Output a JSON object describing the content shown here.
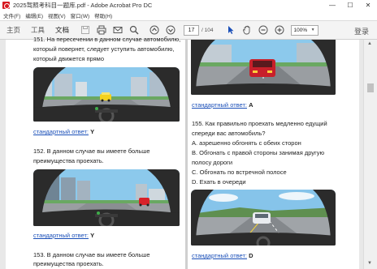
{
  "window": {
    "title": "2025驾照考科目一题库.pdf - Adobe Acrobat Pro DC",
    "controls": [
      "—",
      "☐",
      "✕"
    ]
  },
  "menu": [
    "文件(F)",
    "编辑(E)",
    "视图(V)",
    "窗口(W)",
    "帮助(H)"
  ],
  "toolbar": {
    "tabs": [
      "主页",
      "工具",
      "文档"
    ],
    "icons": [
      "save-icon",
      "print-icon",
      "email-icon",
      "search-icon",
      "page-up-icon",
      "page-down-icon",
      "cursor-icon",
      "hand-icon",
      "zoom-out-icon",
      "zoom-in-icon"
    ],
    "page_current": "17",
    "page_total": "/ 104",
    "zoom": "100%",
    "login": "登录"
  },
  "left_column": {
    "q151_lines": [
      "151. На пересечении в данном случае автомобилю,",
      "который поверне​т, следует уступить автомобилю,",
      "который движется прямо"
    ],
    "answer1_label": "стандартный ответ:",
    "answer1_value": "Y",
    "q152_lines": [
      "152. В данном случае вы имеете больше",
      "преимущества проехать."
    ],
    "answer2_label": "стандартный ответ:",
    "answer2_value": "Y",
    "q153_lines": [
      "153. В данном случае вы имеете больше",
      "преимущества проехать."
    ]
  },
  "right_column": {
    "answer0_label": "стандартный ответ:",
    "answer0_value": "A",
    "q155_lines": [
      "155. Как правильно проехать медленно едущий",
      "спереди вас автомобиль?",
      "A. азрешенно обгонять с обеих сторон",
      "B. Обгонать с правой стороны занимая другую",
      "полосу дороги",
      "C. Обгонать по встречной полосе",
      "D. Ехать в очереди"
    ],
    "answer2_label": "стандартный ответ:",
    "answer2_value": "D"
  },
  "colors": {
    "link": "#1a4fb8",
    "sky": "#7fc6ea",
    "dashboard": "#2b2b2b",
    "acrobat_red": "#d71920"
  }
}
